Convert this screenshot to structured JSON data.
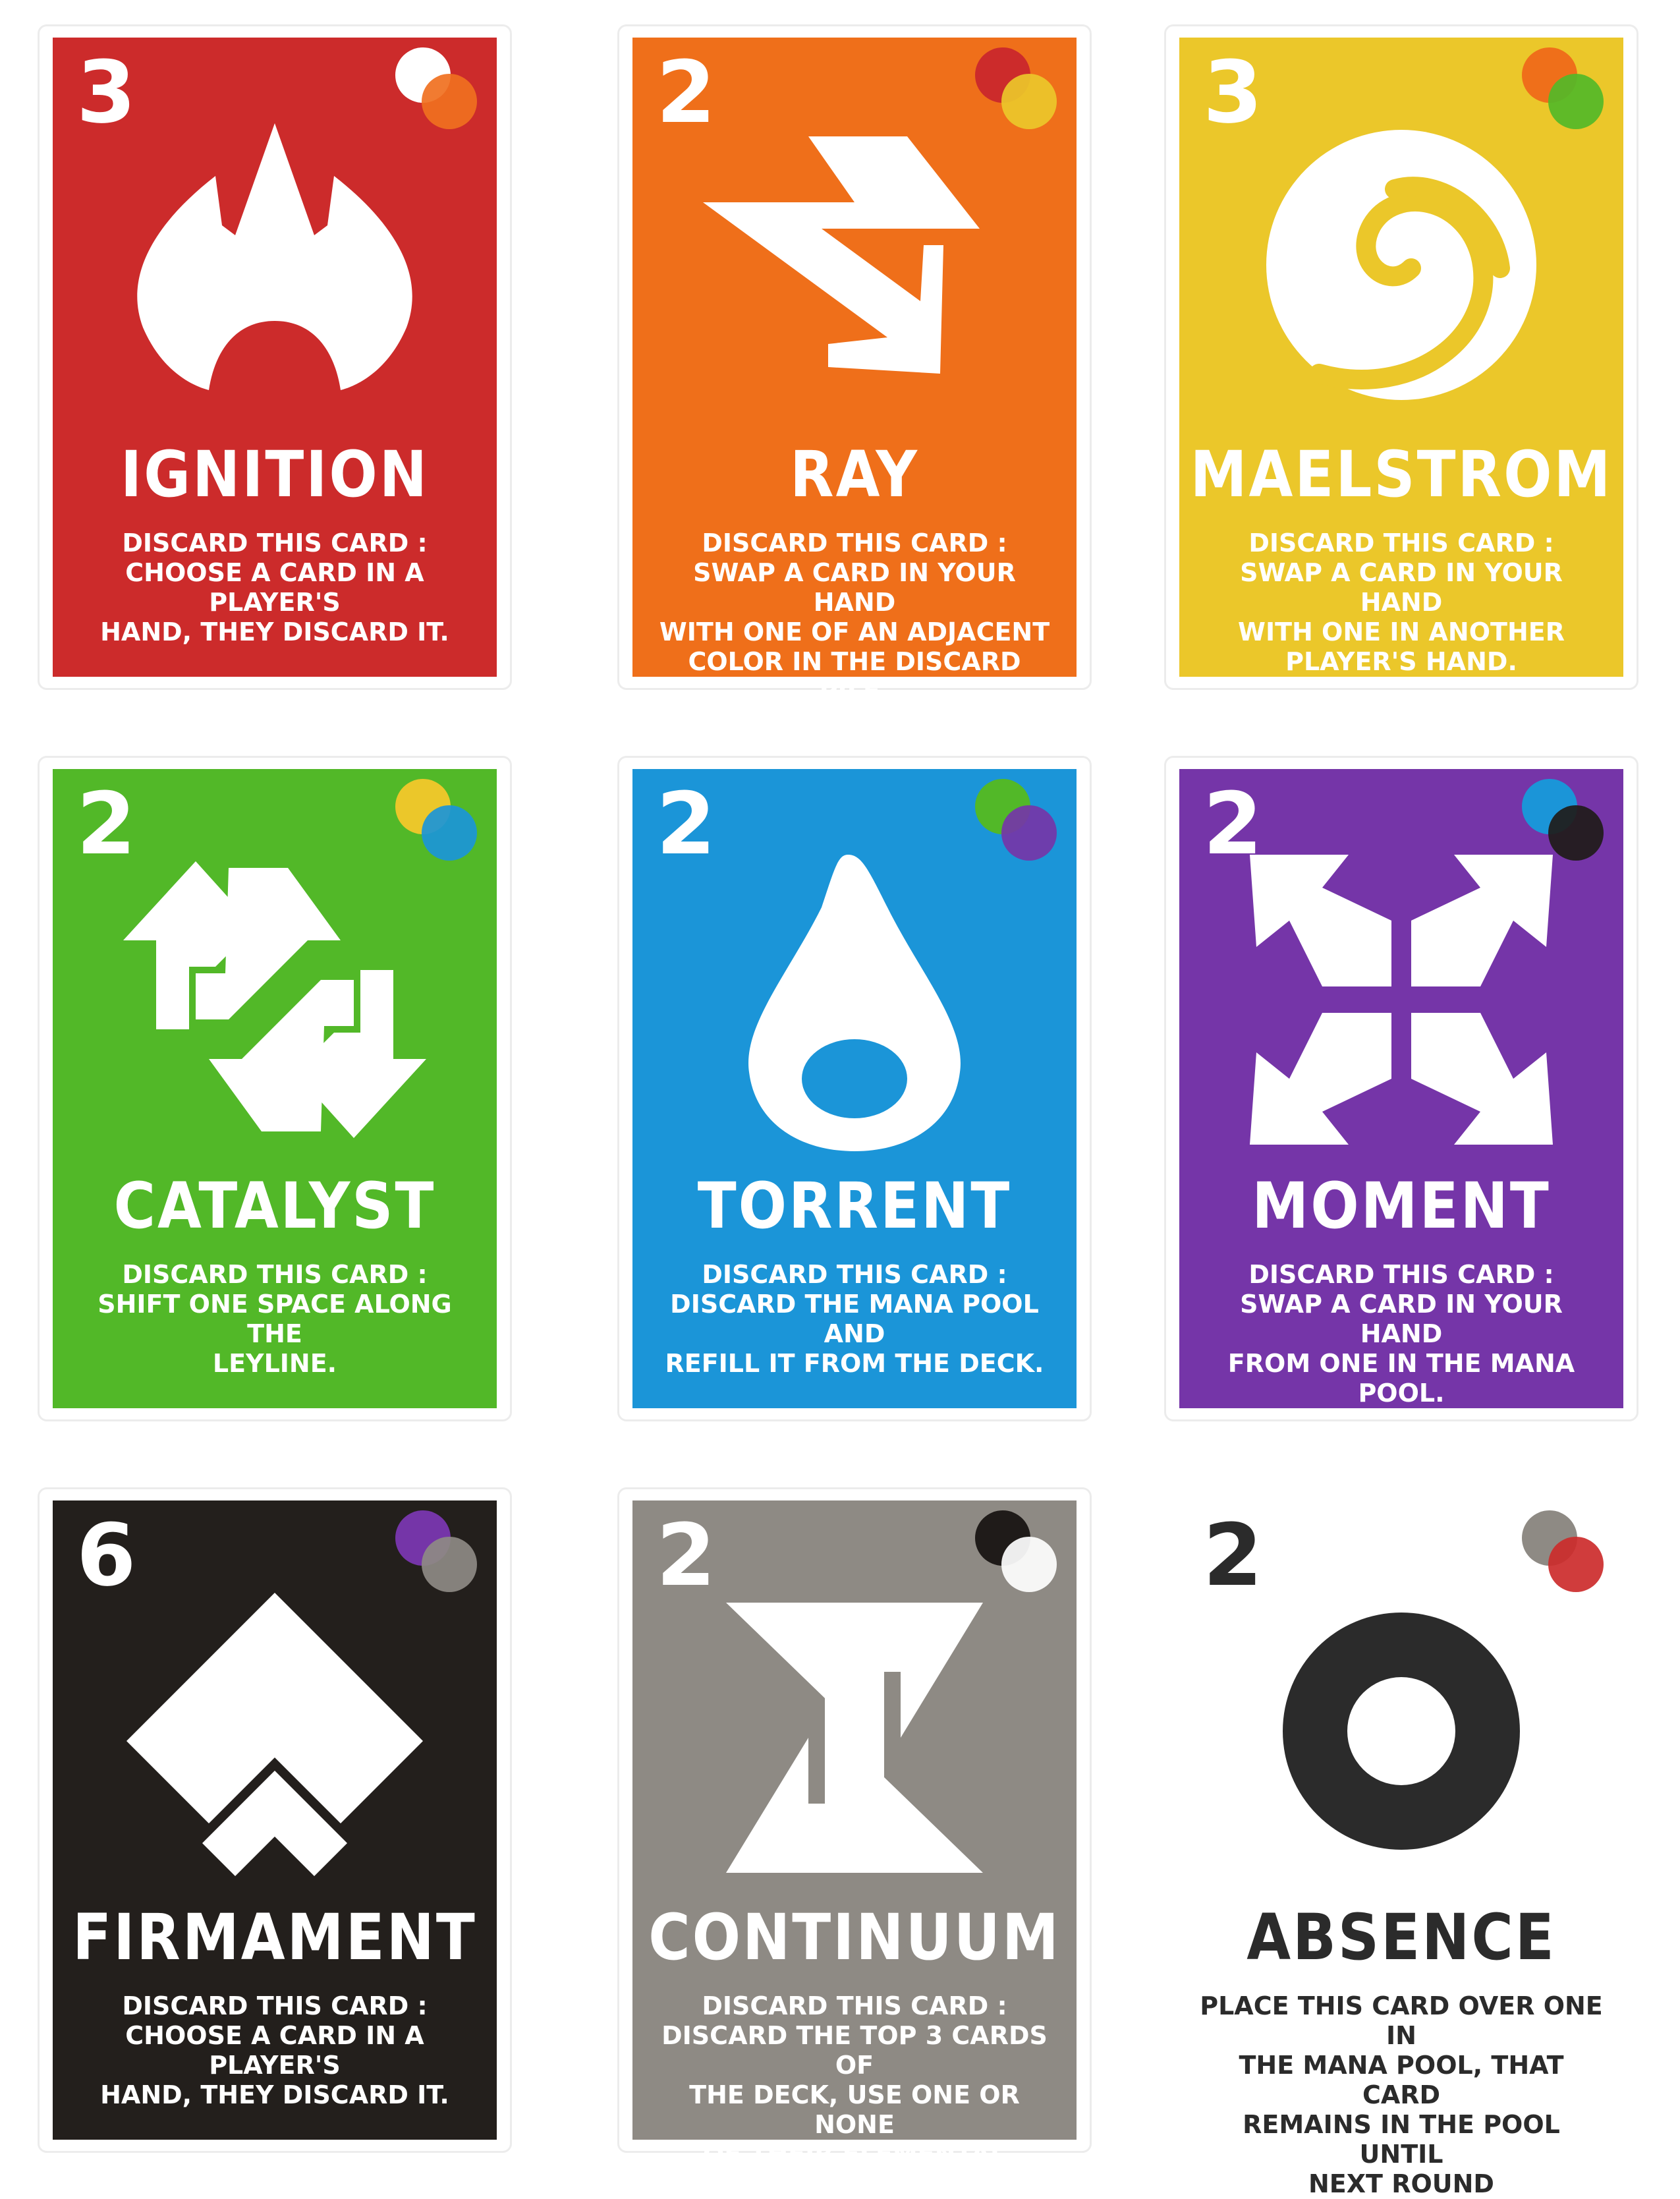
{
  "cards": [
    {
      "cost": "3",
      "title": "IGNITION",
      "line1": "DISCARD THIS CARD :",
      "line2": "CHOOSE A CARD IN A PLAYER'S",
      "line3": "HAND, THEY DISCARD IT.",
      "line4": "",
      "line5": "",
      "bg": "#cc2b2b",
      "orb_a": "#ffffff",
      "orb_b": "#f07020",
      "icon": "flame-icon"
    },
    {
      "cost": "2",
      "title": "RAY",
      "line1": "DISCARD THIS CARD :",
      "line2": "SWAP A CARD IN YOUR HAND",
      "line3": "WITH ONE OF AN ADJACENT",
      "line4": "COLOR IN THE DISCARD PILE.",
      "line5": "",
      "bg": "#ef6f1a",
      "orb_a": "#cc2b2b",
      "orb_b": "#ebc72a",
      "icon": "lightning-arrow-icon"
    },
    {
      "cost": "3",
      "title": "MAELSTROM",
      "line1": "DISCARD THIS CARD :",
      "line2": "SWAP A CARD IN YOUR HAND",
      "line3": "WITH ONE IN ANOTHER",
      "line4": "PLAYER'S HAND.",
      "line5": "",
      "bg": "#ebc72a",
      "orb_a": "#ef6f1a",
      "orb_b": "#52b828",
      "icon": "spiral-icon"
    },
    {
      "cost": "2",
      "title": "CATALYST",
      "line1": "DISCARD THIS CARD :",
      "line2": "SHIFT ONE SPACE ALONG THE",
      "line3": "LEYLINE.",
      "line4": "",
      "line5": "",
      "bg": "#52b828",
      "orb_a": "#ebc72a",
      "orb_b": "#1b95d8",
      "icon": "up-down-arrows-icon"
    },
    {
      "cost": "2",
      "title": "TORRENT",
      "line1": "DISCARD THIS CARD :",
      "line2": "DISCARD THE MANA POOL AND",
      "line3": "REFILL IT FROM THE DECK.",
      "line4": "",
      "line5": "",
      "bg": "#1b95d8",
      "orb_a": "#52b828",
      "orb_b": "#7535a8",
      "icon": "droplet-icon"
    },
    {
      "cost": "2",
      "title": "MOMENT",
      "line1": "DISCARD THIS CARD :",
      "line2": "SWAP A CARD IN YOUR HAND",
      "line3": "FROM ONE IN THE MANA POOL.",
      "line4": "",
      "line5": "",
      "bg": "#7535a8",
      "orb_a": "#1b95d8",
      "orb_b": "#1f1b19",
      "icon": "four-arrows-icon"
    },
    {
      "cost": "6",
      "title": "FIRMAMENT",
      "line1": "DISCARD THIS CARD :",
      "line2": "CHOOSE A CARD IN A PLAYER'S",
      "line3": "HAND, THEY DISCARD IT.",
      "line4": "",
      "line5": "",
      "bg": "#231f1c",
      "orb_a": "#7535a8",
      "orb_b": "#8e8a84",
      "icon": "chevrons-up-icon"
    },
    {
      "cost": "2",
      "title": "CONTINUUM",
      "line1": "DISCARD THIS CARD :",
      "line2": "DISCARD THE TOP 3 CARDS OF",
      "line3": "THE DECK, USE ONE OR NONE",
      "line4": "OF THEIR ELEMENTAL ACTIONS.",
      "line5": "",
      "bg": "#8e8a84",
      "orb_a": "#1f1b19",
      "orb_b": "#ffffff",
      "icon": "hourglass-z-icon"
    },
    {
      "cost": "2",
      "title": "ABSENCE",
      "line1": "PLACE THIS CARD OVER ONE IN",
      "line2": "THE MANA POOL, THAT CARD",
      "line3": "REMAINS IN THE POOL UNTIL",
      "line4": "NEXT ROUND",
      "line5": "",
      "bg": "#ffffff",
      "orb_a": "#8e8a84",
      "orb_b": "#cc2b2b",
      "icon": "ring-icon"
    }
  ]
}
